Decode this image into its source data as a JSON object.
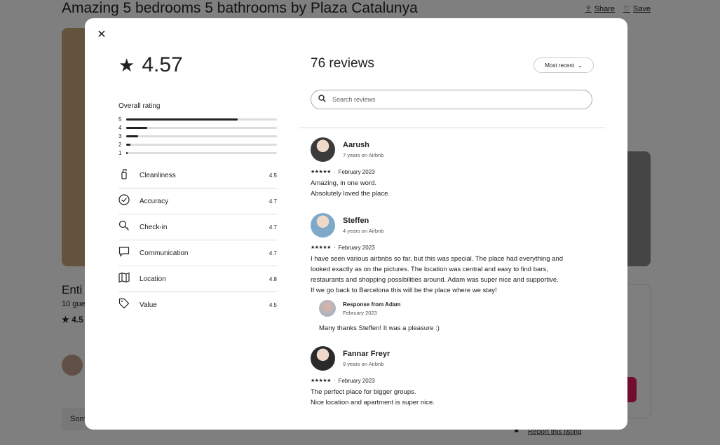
{
  "background": {
    "listing_title": "Amazing 5 bedrooms 5 bathrooms by Plaza Catalunya",
    "share_label": "Share",
    "save_label": "Save",
    "heading_partial": "Enti",
    "guests_partial": "10 gue",
    "rating_partial": "4.5",
    "some_partial": "Som",
    "report_label": "Report this listing"
  },
  "modal": {
    "close_icon": "close-icon",
    "overall": {
      "value": "4.57",
      "label": "Overall rating",
      "distribution": [
        {
          "stars": "5",
          "fraction": 0.74
        },
        {
          "stars": "4",
          "fraction": 0.14
        },
        {
          "stars": "3",
          "fraction": 0.08
        },
        {
          "stars": "2",
          "fraction": 0.03
        },
        {
          "stars": "1",
          "fraction": 0.01
        }
      ]
    },
    "categories": [
      {
        "name": "Cleanliness",
        "value": "4.5",
        "icon": "spray-bottle-icon"
      },
      {
        "name": "Accuracy",
        "value": "4.7",
        "icon": "check-circle-icon"
      },
      {
        "name": "Check-in",
        "value": "4.7",
        "icon": "key-icon"
      },
      {
        "name": "Communication",
        "value": "4.7",
        "icon": "chat-bubble-icon"
      },
      {
        "name": "Location",
        "value": "4.8",
        "icon": "map-icon"
      },
      {
        "name": "Value",
        "value": "4.5",
        "icon": "tag-icon"
      }
    ],
    "reviews_header": "76 reviews",
    "sort_label": "Most recent",
    "search_placeholder": "Search reviews",
    "reviews": [
      {
        "name": "Aarush",
        "tenure": "7 years on Airbnb",
        "stars": "★★★★★",
        "date": "February 2023",
        "lines": [
          "Amazing, in one word.",
          "Absolutely loved the place."
        ],
        "avatar_color": "#3b3b3b"
      },
      {
        "name": "Steffen",
        "tenure": "4 years on Airbnb",
        "stars": "★★★★★",
        "date": "February 2023",
        "lines": [
          "I have seen various airbnbs so far, but this was special. The place had everything and",
          "looked exactly as on the pictures. The location was central and easy to find bars,",
          "restaurants and shopping possibilities around. Adam was super nice and supportive.",
          "If we go back to Barcelona this will be the place where we stay!"
        ],
        "avatar_color": "#7fa9c9",
        "response": {
          "title": "Response from Adam",
          "date": "February 2023",
          "text": "Many thanks Steffen! It was a pleasure :)"
        }
      },
      {
        "name": "Fannar Freyr",
        "tenure": "9 years on Airbnb",
        "stars": "★★★★★",
        "date": "February 2023",
        "lines": [
          "The perfect place for bigger groups.",
          "Nice location and apartment is super nice."
        ],
        "avatar_color": "#2a2a2a"
      }
    ]
  }
}
